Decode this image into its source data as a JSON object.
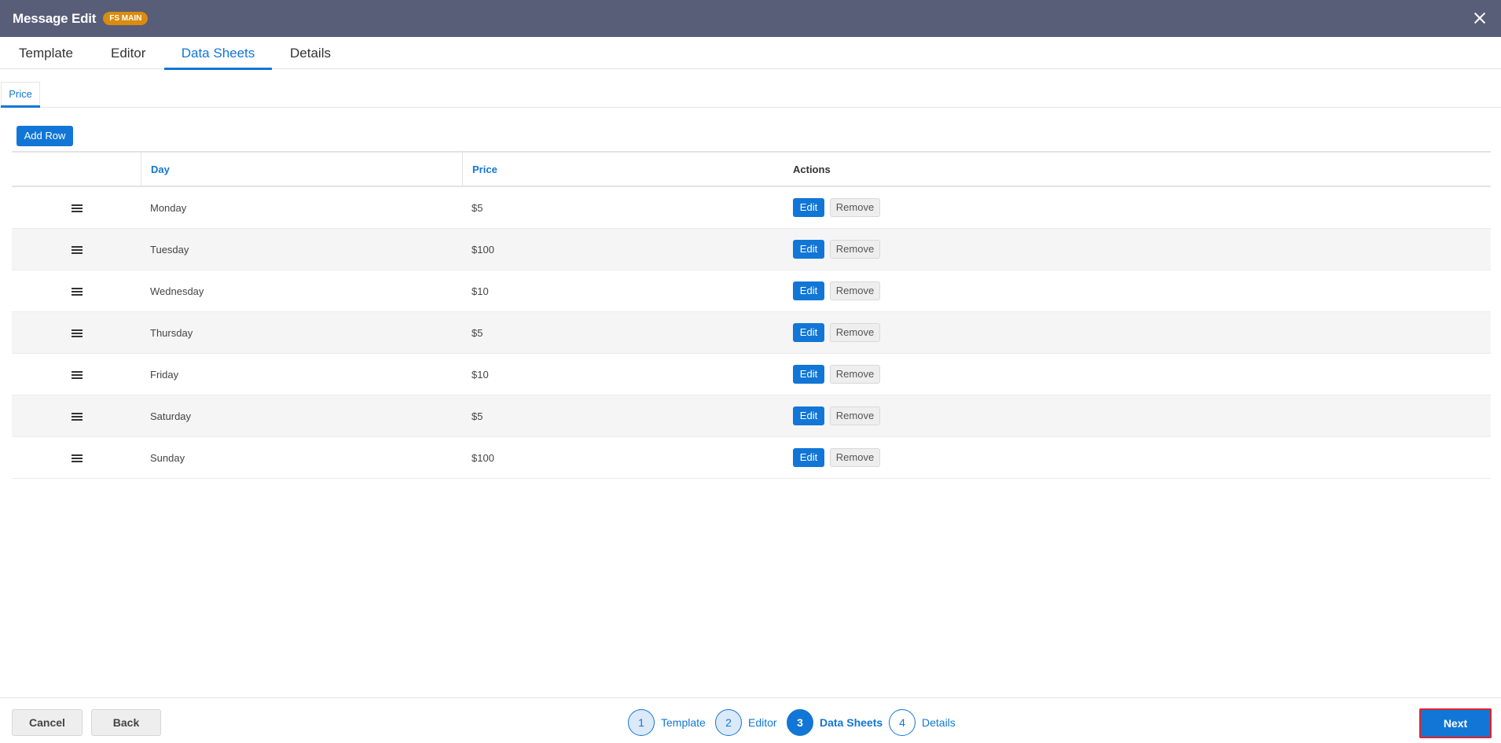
{
  "window": {
    "title": "Message Edit",
    "badge": "FS MAIN"
  },
  "tabs": [
    {
      "label": "Template"
    },
    {
      "label": "Editor"
    },
    {
      "label": "Data Sheets",
      "active": true
    },
    {
      "label": "Details"
    }
  ],
  "sheet_tabs": [
    {
      "label": "Price",
      "active": true
    }
  ],
  "toolbar": {
    "add_row_label": "Add Row"
  },
  "table": {
    "columns": {
      "day": "Day",
      "price": "Price",
      "actions": "Actions"
    },
    "edit_label": "Edit",
    "remove_label": "Remove",
    "rows": [
      {
        "day": "Monday",
        "price": "$5"
      },
      {
        "day": "Tuesday",
        "price": "$100"
      },
      {
        "day": "Wednesday",
        "price": "$10"
      },
      {
        "day": "Thursday",
        "price": "$5"
      },
      {
        "day": "Friday",
        "price": "$10"
      },
      {
        "day": "Saturday",
        "price": "$5"
      },
      {
        "day": "Sunday",
        "price": "$100"
      }
    ]
  },
  "footer": {
    "cancel_label": "Cancel",
    "back_label": "Back",
    "next_label": "Next",
    "steps": [
      {
        "num": "1",
        "label": "Template"
      },
      {
        "num": "2",
        "label": "Editor"
      },
      {
        "num": "3",
        "label": "Data Sheets",
        "active": true
      },
      {
        "num": "4",
        "label": "Details"
      }
    ]
  },
  "colors": {
    "accent": "#1276d6",
    "titlebar": "#585d78",
    "badge": "#d98c0f",
    "highlight": "#e0232e"
  }
}
